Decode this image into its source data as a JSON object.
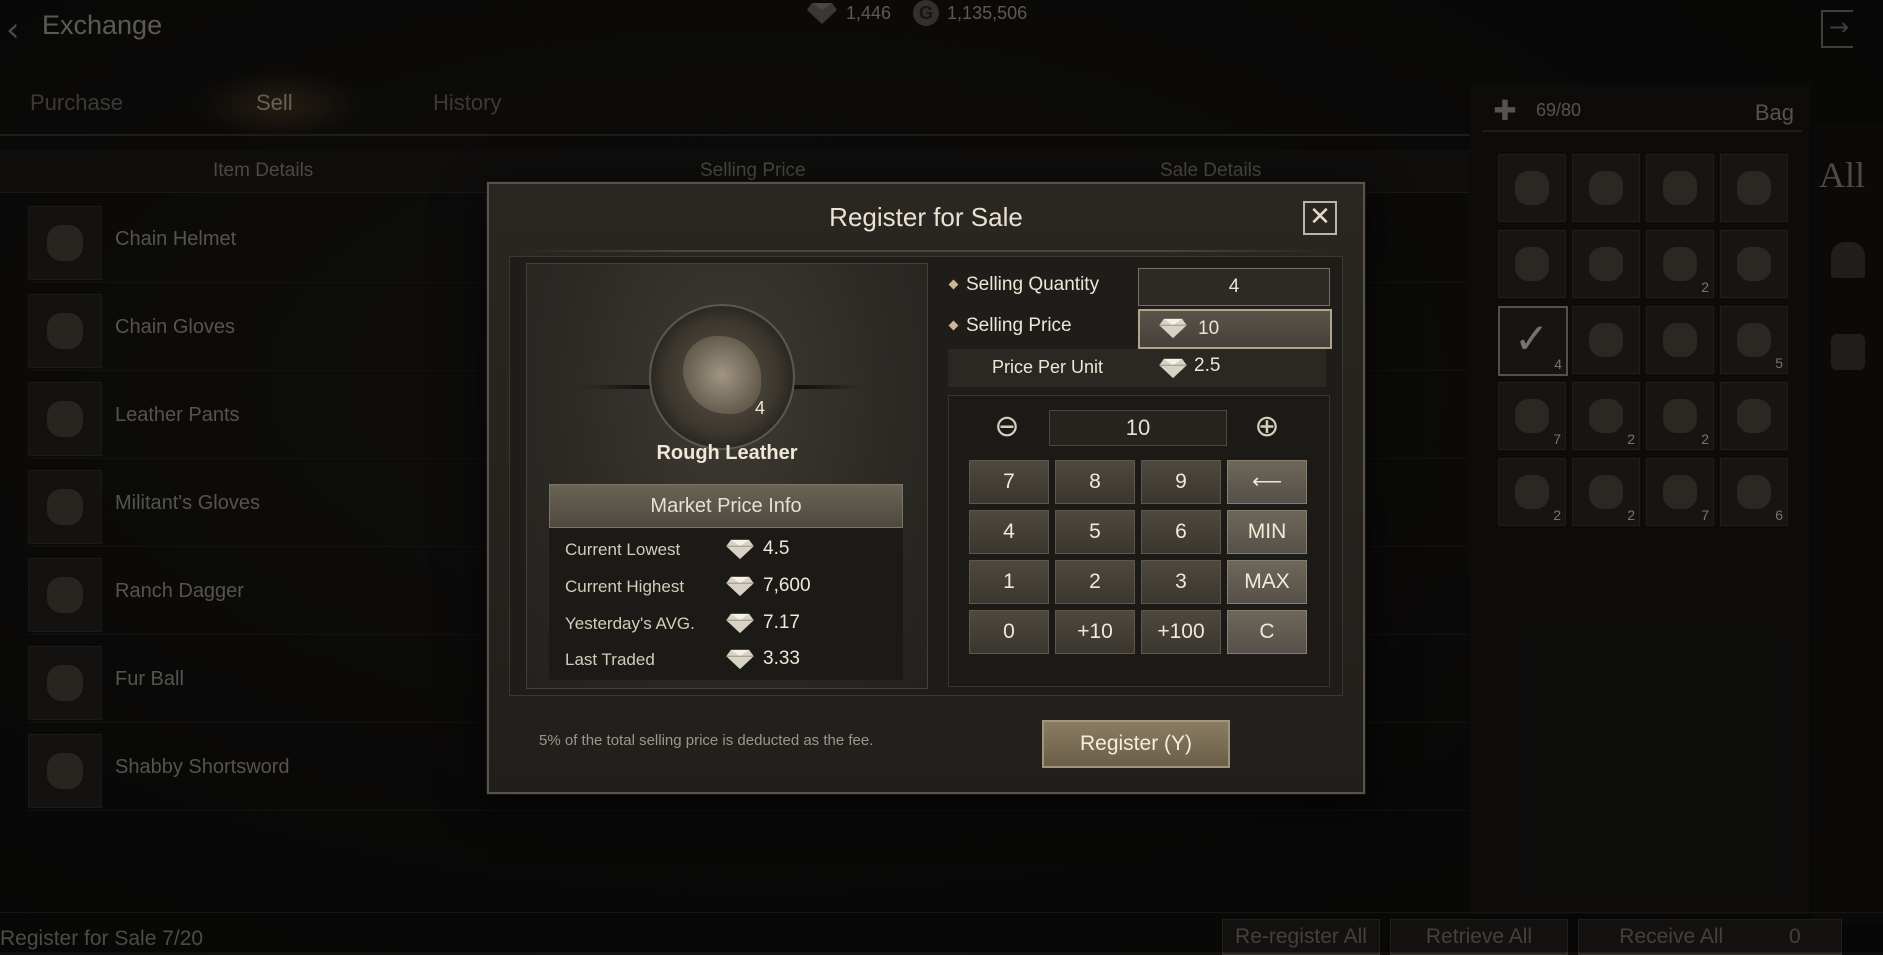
{
  "header": {
    "title": "Exchange",
    "gems": "1,446",
    "gold_symbol": "G",
    "gold": "1,135,506"
  },
  "tabs": [
    "Purchase",
    "Sell",
    "History"
  ],
  "table": {
    "columns": [
      "Item Details",
      "Selling Price",
      "Sale Details"
    ],
    "rows": [
      "Chain Helmet",
      "Chain Gloves",
      "Leather Pants",
      "Militant's Gloves",
      "Ranch Dagger",
      "Fur Ball",
      "Shabby Shortsword"
    ]
  },
  "bag": {
    "capacity": "69/80",
    "title": "Bag",
    "filter": "All",
    "counts": [
      "",
      "",
      "",
      "",
      "",
      "",
      "2",
      "",
      "4",
      "",
      "",
      "5",
      "7",
      "2",
      "2",
      "",
      "2",
      "2",
      "7",
      "6"
    ]
  },
  "bottom": {
    "register_count": "Register for Sale 7/20",
    "reregister": "Re-register All",
    "retrieve": "Retrieve All",
    "receive": "Receive All",
    "receive_amount": "0"
  },
  "modal": {
    "title": "Register for Sale",
    "close_symbol": "✕",
    "item_name": "Rough Leather",
    "item_count": "4",
    "market_title": "Market Price Info",
    "market": [
      {
        "label": "Current Lowest",
        "value": "4.5"
      },
      {
        "label": "Current Highest",
        "value": "7,600"
      },
      {
        "label": "Yesterday's AVG.",
        "value": "7.17"
      },
      {
        "label": "Last Traded",
        "value": "3.33"
      }
    ],
    "quantity_label": "Selling Quantity",
    "quantity": "4",
    "price_label": "Selling Price",
    "price": "10",
    "ppu_label": "Price Per Unit",
    "ppu": "2.5",
    "keypad": {
      "minus": "⊖",
      "display": "10",
      "plus": "⊕",
      "keys": [
        "7",
        "8",
        "9",
        "⟵",
        "4",
        "5",
        "6",
        "MIN",
        "1",
        "2",
        "3",
        "MAX",
        "0",
        "+10",
        "+100",
        "C"
      ]
    },
    "fee_note": "5% of the total selling price is deducted as the fee.",
    "register": "Register (Y)"
  }
}
